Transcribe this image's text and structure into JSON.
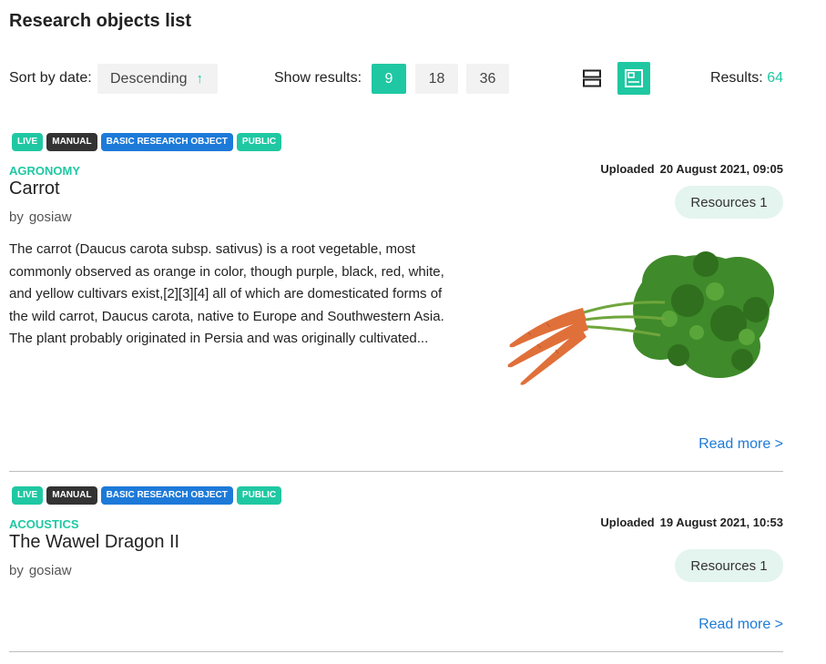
{
  "page": {
    "title": "Research objects list"
  },
  "toolbar": {
    "sort_label": "Sort by date:",
    "sort_value": "Descending",
    "show_label": "Show results:",
    "page_sizes": [
      "9",
      "18",
      "36"
    ],
    "active_page_size": "9",
    "results_label": "Results:",
    "results_count": "64"
  },
  "colors": {
    "accent": "#1fc8a2",
    "link": "#1d7ad8",
    "manual_tag": "#333333"
  },
  "items": [
    {
      "tags": [
        "LIVE",
        "MANUAL",
        "BASIC RESEARCH OBJECT",
        "PUBLIC"
      ],
      "category": "AGRONOMY",
      "uploaded_label": "Uploaded",
      "uploaded_date": "20 August 2021, 09:05",
      "title": "Carrot",
      "by_label": "by",
      "author": "gosiaw",
      "resources": "Resources 1",
      "description": "The carrot (Daucus carota subsp. sativus) is a root vegetable, most commonly observed as orange in color, though purple, black, red, white, and yellow cultivars exist,[2][3][4] all of which are domesticated forms of the wild carrot, Daucus carota, native to Europe and Southwestern Asia. The plant probably originated in Persia and was originally cultivated...",
      "read_more": "Read more >"
    },
    {
      "tags": [
        "LIVE",
        "MANUAL",
        "BASIC RESEARCH OBJECT",
        "PUBLIC"
      ],
      "category": "ACOUSTICS",
      "uploaded_label": "Uploaded",
      "uploaded_date": "19 August 2021, 10:53",
      "title": "The Wawel Dragon II",
      "by_label": "by",
      "author": "gosiaw",
      "resources": "Resources 1",
      "read_more": "Read more >"
    }
  ]
}
